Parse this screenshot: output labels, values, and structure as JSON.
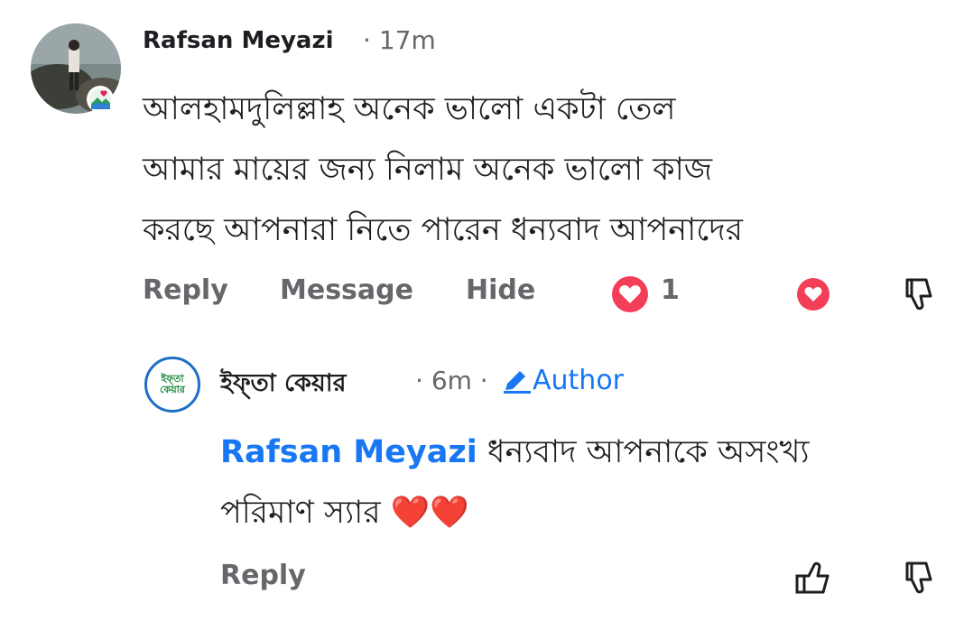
{
  "comment": {
    "author": "Rafsan Meyazi",
    "time": "17m",
    "lines": [
      "আলহামদুলিল্লাহ অনেক ভালো একটা তেল",
      "আমার মায়ের জন্য নিলাম অনেক ভালো কাজ",
      "করছে আপনারা নিতে পারেন ধন্যবাদ আপনাদের"
    ],
    "actions": {
      "reply": "Reply",
      "message": "Message",
      "hide": "Hide"
    },
    "reaction_count": "1"
  },
  "reply": {
    "author": "ইফ্তা কেয়ার",
    "time": "6m",
    "author_badge": "Author",
    "avatar_text": "ইফ্তা কেয়ার",
    "mention": "Rafsan Meyazi",
    "line1_rest": " ধন্যবাদ আপনাকে অসংখ্য",
    "line2": "পরিমাণ স্যার ❤️❤️",
    "actions": {
      "reply": "Reply"
    }
  },
  "icons": {
    "love": "heart-reaction-icon",
    "love_outline": "love-react-button-icon",
    "dislike": "thumbs-down-icon",
    "like": "thumbs-up-icon",
    "pencil": "pencil-icon"
  },
  "colors": {
    "love": "#f33e58",
    "accent": "#1877f2",
    "muted": "#65676b"
  }
}
